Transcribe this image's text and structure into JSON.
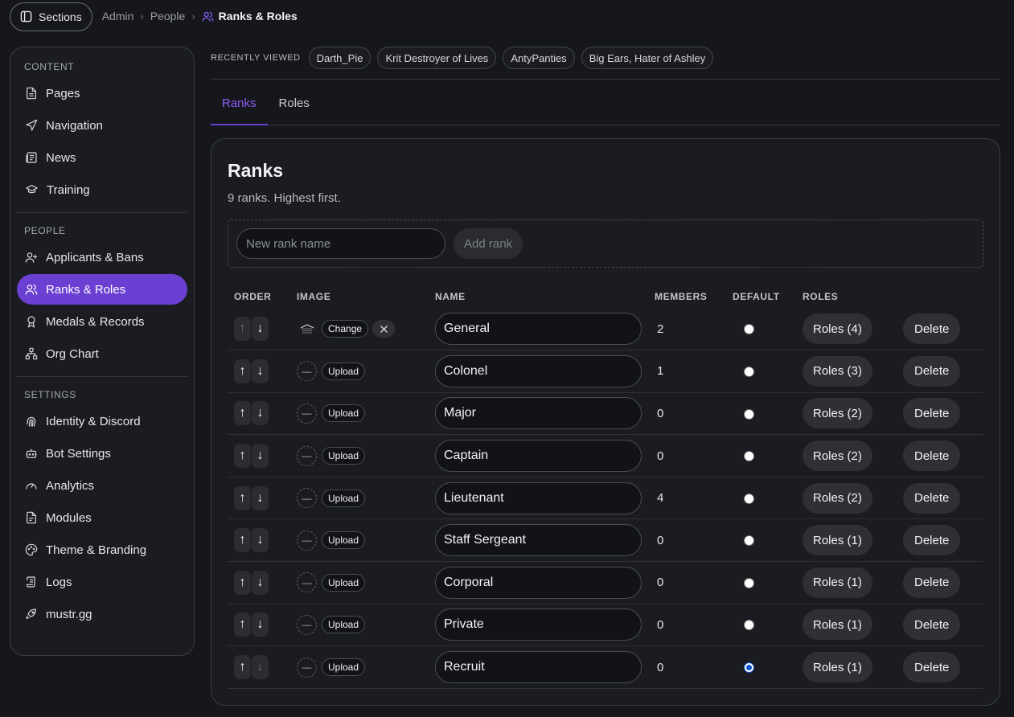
{
  "topbar": {
    "sections_label": "Sections",
    "breadcrumb": [
      "Admin",
      "People"
    ],
    "current": "Ranks & Roles"
  },
  "sidebar": {
    "groups": [
      {
        "title": "CONTENT",
        "items": [
          {
            "label": "Pages",
            "icon": "file-icon"
          },
          {
            "label": "Navigation",
            "icon": "navigation-icon"
          },
          {
            "label": "News",
            "icon": "newspaper-icon"
          },
          {
            "label": "Training",
            "icon": "graduation-cap-icon"
          }
        ]
      },
      {
        "title": "PEOPLE",
        "items": [
          {
            "label": "Applicants & Bans",
            "icon": "user-plus-icon"
          },
          {
            "label": "Ranks & Roles",
            "icon": "users-icon",
            "active": true
          },
          {
            "label": "Medals & Records",
            "icon": "award-icon"
          },
          {
            "label": "Org Chart",
            "icon": "org-chart-icon"
          }
        ]
      },
      {
        "title": "SETTINGS",
        "items": [
          {
            "label": "Identity & Discord",
            "icon": "fingerprint-icon"
          },
          {
            "label": "Bot Settings",
            "icon": "bot-icon"
          },
          {
            "label": "Analytics",
            "icon": "gauge-icon"
          },
          {
            "label": "Modules",
            "icon": "document-icon"
          },
          {
            "label": "Theme & Branding",
            "icon": "palette-icon"
          },
          {
            "label": "Logs",
            "icon": "scroll-icon"
          },
          {
            "label": "mustr.gg",
            "icon": "rocket-icon"
          }
        ]
      }
    ]
  },
  "recent": {
    "label": "RECENTLY VIEWED",
    "items": [
      "Darth_Pie",
      "Krit Destroyer of Lives",
      "AntyPanties",
      "Big Ears, Hater of Ashley"
    ]
  },
  "tabs": [
    {
      "label": "Ranks",
      "active": true
    },
    {
      "label": "Roles",
      "active": false
    }
  ],
  "card": {
    "title": "Ranks",
    "subtitle": "9 ranks. Highest first.",
    "new_rank_placeholder": "New rank name",
    "add_rank_label": "Add rank"
  },
  "table": {
    "headers": [
      "ORDER",
      "IMAGE",
      "NAME",
      "MEMBERS",
      "DEFAULT",
      "ROLES"
    ],
    "change_label": "Change",
    "upload_label": "Upload",
    "delete_label": "Delete",
    "rows": [
      {
        "name": "General",
        "members": "2",
        "default": false,
        "roles": "Roles (4)",
        "has_image": true,
        "up_enabled": false,
        "down_enabled": true
      },
      {
        "name": "Colonel",
        "members": "1",
        "default": false,
        "roles": "Roles (3)",
        "has_image": false,
        "up_enabled": true,
        "down_enabled": true
      },
      {
        "name": "Major",
        "members": "0",
        "default": false,
        "roles": "Roles (2)",
        "has_image": false,
        "up_enabled": true,
        "down_enabled": true
      },
      {
        "name": "Captain",
        "members": "0",
        "default": false,
        "roles": "Roles (2)",
        "has_image": false,
        "up_enabled": true,
        "down_enabled": true
      },
      {
        "name": "Lieutenant",
        "members": "4",
        "default": false,
        "roles": "Roles (2)",
        "has_image": false,
        "up_enabled": true,
        "down_enabled": true
      },
      {
        "name": "Staff Sergeant",
        "members": "0",
        "default": false,
        "roles": "Roles (1)",
        "has_image": false,
        "up_enabled": true,
        "down_enabled": true
      },
      {
        "name": "Corporal",
        "members": "0",
        "default": false,
        "roles": "Roles (1)",
        "has_image": false,
        "up_enabled": true,
        "down_enabled": true
      },
      {
        "name": "Private",
        "members": "0",
        "default": false,
        "roles": "Roles (1)",
        "has_image": false,
        "up_enabled": true,
        "down_enabled": true
      },
      {
        "name": "Recruit",
        "members": "0",
        "default": true,
        "roles": "Roles (1)",
        "has_image": false,
        "up_enabled": true,
        "down_enabled": false
      }
    ]
  },
  "colors": {
    "accent": "#6a3fd1",
    "accent_text": "#8b5cf6",
    "background": "#15171c",
    "card": "#1a1c21"
  }
}
